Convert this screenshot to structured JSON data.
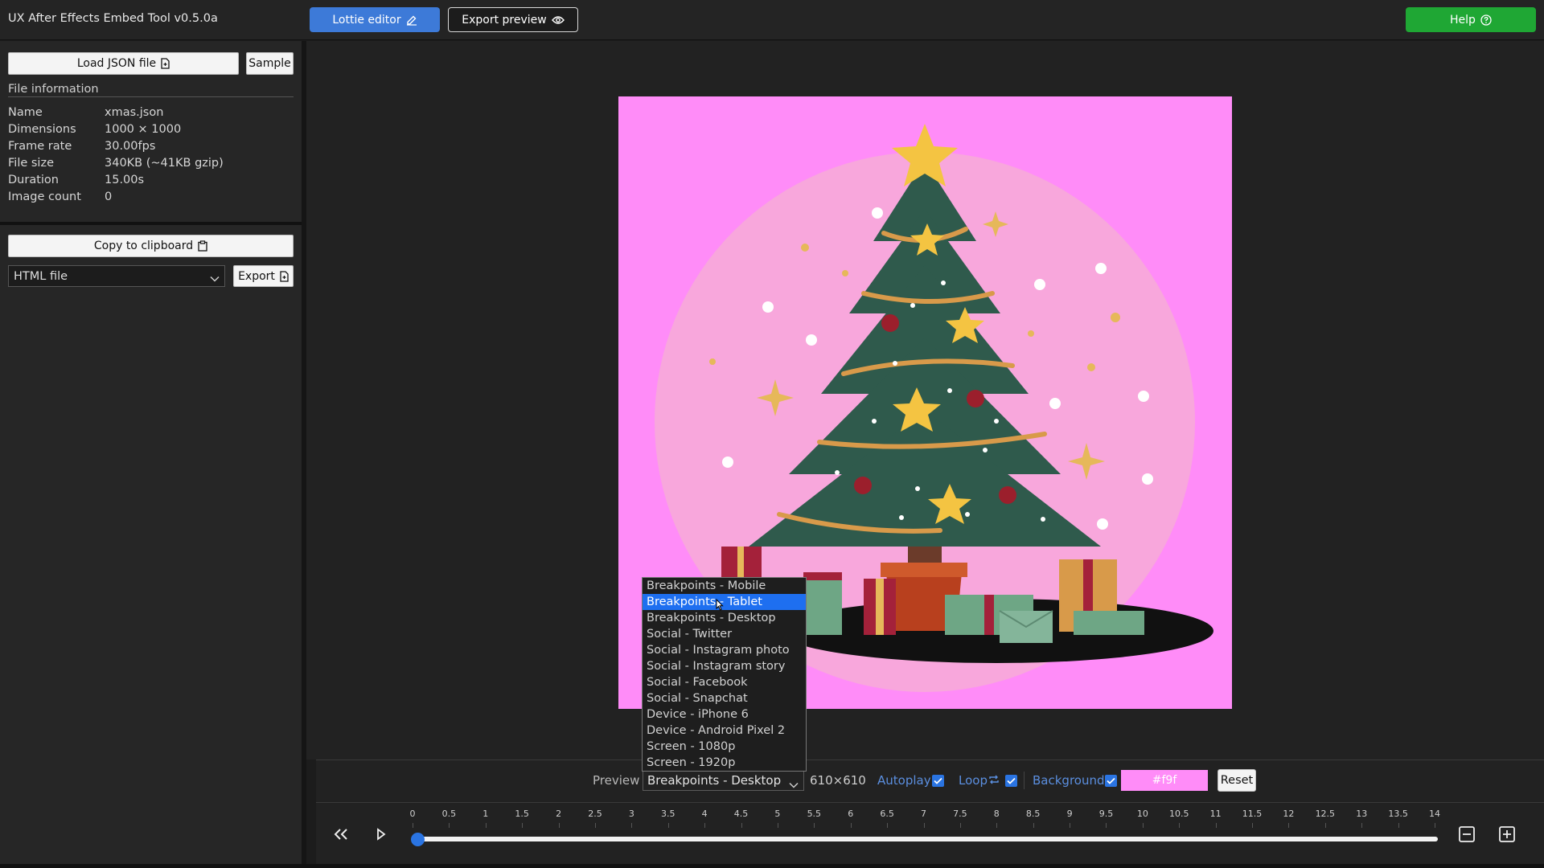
{
  "app": {
    "title": "UX After Effects Embed Tool v0.5.0a"
  },
  "header": {
    "lottie_editor_label": "Lottie editor",
    "export_preview_label": "Export preview",
    "help_label": "Help"
  },
  "sidebar": {
    "load_json_label": "Load JSON file",
    "sample_label": "Sample",
    "file_info_title": "File information",
    "file_info": [
      {
        "key": "Name",
        "value": "xmas.json"
      },
      {
        "key": "Dimensions",
        "value": "1000 × 1000"
      },
      {
        "key": "Frame rate",
        "value": "30.00fps"
      },
      {
        "key": "File size",
        "value": "340KB (~41KB gzip)"
      },
      {
        "key": "Duration",
        "value": "15.00s"
      },
      {
        "key": "Image count",
        "value": "0"
      }
    ],
    "copy_label": "Copy to clipboard",
    "format_value": "HTML file",
    "export_label": "Export"
  },
  "preview": {
    "label": "Preview",
    "selected": "Breakpoints - Desktop",
    "size": "610×610",
    "autoplay_label": "Autoplay",
    "autoplay": true,
    "loop_label": "Loop",
    "loop": true,
    "background_label": "Background",
    "background": true,
    "bg_color": "#f9f",
    "reset_label": "Reset",
    "options": [
      "Breakpoints - Mobile",
      "Breakpoints - Tablet",
      "Breakpoints - Desktop",
      "Social - Twitter",
      "Social - Instagram photo",
      "Social - Instagram story",
      "Social - Facebook",
      "Social - Snapchat",
      "Device - iPhone 6",
      "Device - Android Pixel 2",
      "Screen - 1080p",
      "Screen - 1920p"
    ],
    "highlighted_index": 1
  },
  "timeline": {
    "ticks": [
      "0",
      "0.5",
      "1",
      "1.5",
      "2",
      "2.5",
      "3",
      "3.5",
      "4",
      "4.5",
      "5",
      "5.5",
      "6",
      "6.5",
      "7",
      "7.5",
      "8",
      "8.5",
      "9",
      "9.5",
      "10",
      "10.5",
      "11",
      "11.5",
      "12",
      "12.5",
      "13",
      "13.5",
      "14"
    ],
    "position_seconds": 0
  },
  "colors": {
    "accent_blue": "#3d7ad8",
    "help_green": "#1fa734",
    "canvas_bg": "#ff8cf8",
    "highlight": "#1e6ff0"
  }
}
